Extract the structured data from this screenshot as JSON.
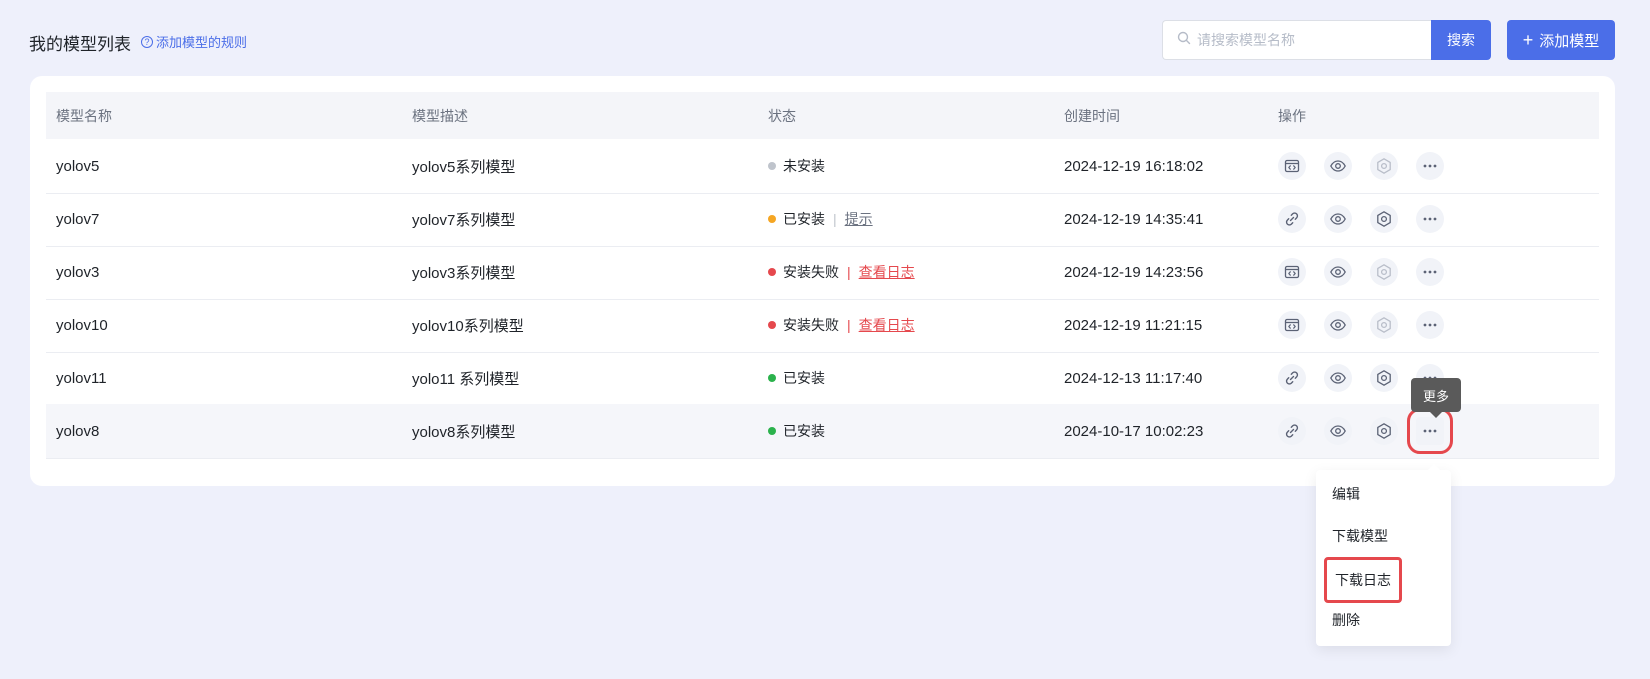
{
  "header": {
    "title": "我的模型列表",
    "rules_link": "添加模型的规则",
    "rules_icon": "?",
    "search_placeholder": "请搜索模型名称",
    "search_button": "搜索",
    "add_button": "添加模型",
    "add_icon": "+"
  },
  "table": {
    "columns": [
      "模型名称",
      "模型描述",
      "状态",
      "创建时间",
      "操作"
    ],
    "rows": [
      {
        "name": "yolov5",
        "desc": "yolov5系列模型",
        "status": "未安装",
        "status_color": "#bfc4cc",
        "action": "",
        "time": "2024-12-19 16:18:02",
        "first_op": "deploy-icon",
        "settings_enabled": false
      },
      {
        "name": "yolov7",
        "desc": "yolov7系列模型",
        "status": "已安装",
        "status_color": "#f5a623",
        "action": "提示",
        "time": "2024-12-19 14:35:41",
        "first_op": "link-icon",
        "settings_enabled": true
      },
      {
        "name": "yolov3",
        "desc": "yolov3系列模型",
        "status": "安装失败",
        "status_color": "#e5484d",
        "action": "查看日志",
        "time": "2024-12-19 14:23:56",
        "first_op": "deploy-icon",
        "settings_enabled": false
      },
      {
        "name": "yolov10",
        "desc": "yolov10系列模型",
        "status": "安装失败",
        "status_color": "#e5484d",
        "action": "查看日志",
        "time": "2024-12-19 11:21:15",
        "first_op": "deploy-icon",
        "settings_enabled": false
      },
      {
        "name": "yolov11",
        "desc": "yolo11 系列模型",
        "status": "已安装",
        "status_color": "#2bb24c",
        "action": "",
        "time": "2024-12-13 11:17:40",
        "first_op": "link-icon",
        "settings_enabled": true
      },
      {
        "name": "yolov8",
        "desc": "yolov8系列模型",
        "status": "已安装",
        "status_color": "#2bb24c",
        "action": "",
        "time": "2024-10-17 10:02:23",
        "first_op": "link-icon",
        "settings_enabled": true
      }
    ]
  },
  "tooltip": "更多",
  "more_menu": {
    "items": [
      "编辑",
      "下载模型",
      "下载日志",
      "删除"
    ],
    "highlighted": "下载日志"
  },
  "colors": {
    "accent": "#4b6ee8",
    "highlight_border": "#e5484d",
    "page_bg": "#eef0fb"
  }
}
